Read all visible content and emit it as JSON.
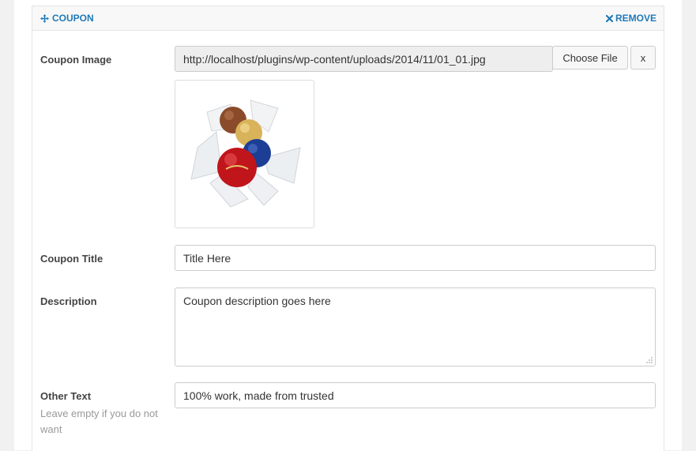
{
  "header": {
    "title": "COUPON",
    "remove_label": "REMOVE",
    "move_icon": "move-icon",
    "remove_icon": "close-icon"
  },
  "image_field": {
    "label": "Coupon Image",
    "value": "http://localhost/plugins/wp-content/uploads/2014/11/01_01.jpg",
    "choose_label": "Choose File",
    "clear_label": "x"
  },
  "title_field": {
    "label": "Coupon Title",
    "value": "Title Here"
  },
  "description_field": {
    "label": "Description",
    "value": "Coupon description goes here"
  },
  "other_text_field": {
    "label": "Other Text",
    "hint": "Leave empty if you do not want",
    "value": "100% work, made from trusted"
  },
  "colors": {
    "accent": "#1f7ab8",
    "label": "#444444",
    "hint": "#999999"
  }
}
